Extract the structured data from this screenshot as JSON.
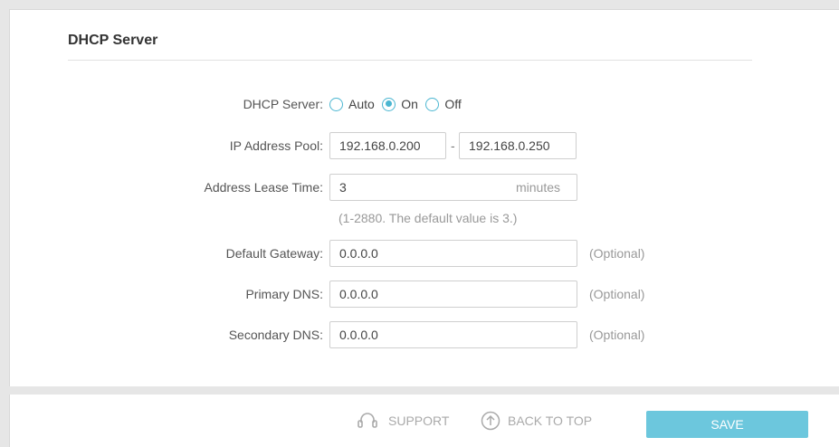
{
  "section": {
    "title": "DHCP Server"
  },
  "dhcp_server": {
    "label": "DHCP Server:",
    "options": [
      "Auto",
      "On",
      "Off"
    ],
    "selected": "On"
  },
  "ip_pool": {
    "label": "IP Address Pool:",
    "start": "192.168.0.200",
    "separator": "-",
    "end": "192.168.0.250"
  },
  "lease_time": {
    "label": "Address Lease Time:",
    "value": "3",
    "unit": "minutes",
    "hint": "(1-2880. The default value is 3.)"
  },
  "default_gateway": {
    "label": "Default Gateway:",
    "value": "0.0.0.0",
    "note": "(Optional)"
  },
  "primary_dns": {
    "label": "Primary DNS:",
    "value": "0.0.0.0",
    "note": "(Optional)"
  },
  "secondary_dns": {
    "label": "Secondary DNS:",
    "value": "0.0.0.0",
    "note": "(Optional)"
  },
  "footer": {
    "support_label": "SUPPORT",
    "back_to_top_label": "BACK TO TOP",
    "save_label": "SAVE",
    "support_icon": "headset-icon",
    "back_to_top_icon": "arrow-up-circle-icon"
  },
  "colors": {
    "accent": "#4bb6d1",
    "save_button": "#6cc7dd",
    "background": "#e6e6e6",
    "muted_text": "#999999"
  }
}
